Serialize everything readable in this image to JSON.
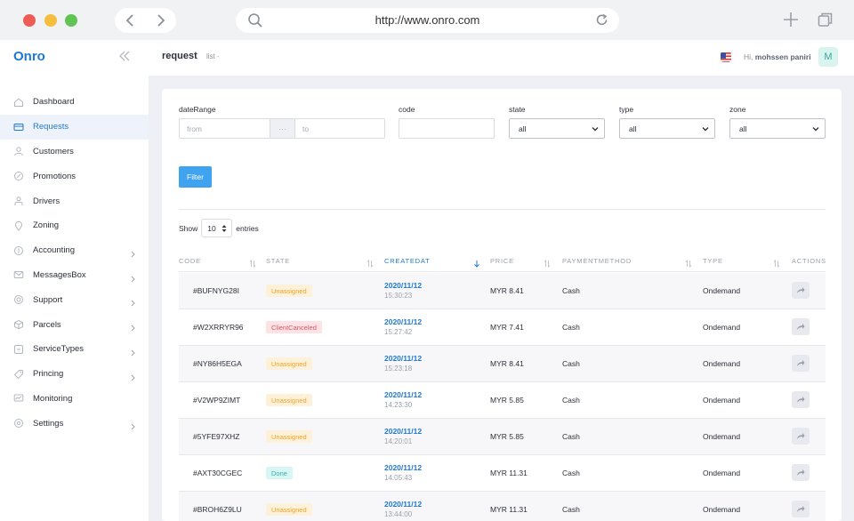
{
  "browser": {
    "url": "http://www.onro.com"
  },
  "sidebar": {
    "logo": "Onro",
    "items": [
      {
        "label": "Dashboard",
        "icon": "home-icon",
        "active": false,
        "chevron": false
      },
      {
        "label": "Requests",
        "icon": "requests-icon",
        "active": true,
        "chevron": false
      },
      {
        "label": "Customers",
        "icon": "customers-icon",
        "active": false,
        "chevron": false
      },
      {
        "label": "Promotions",
        "icon": "promotions-icon",
        "active": false,
        "chevron": false
      },
      {
        "label": "Drivers",
        "icon": "drivers-icon",
        "active": false,
        "chevron": false
      },
      {
        "label": "Zoning",
        "icon": "zoning-icon",
        "active": false,
        "chevron": false
      },
      {
        "label": "Accounting",
        "icon": "accounting-icon",
        "active": false,
        "chevron": true
      },
      {
        "label": "MessagesBox",
        "icon": "messages-icon",
        "active": false,
        "chevron": true
      },
      {
        "label": "Support",
        "icon": "support-icon",
        "active": false,
        "chevron": true
      },
      {
        "label": "Parcels",
        "icon": "parcels-icon",
        "active": false,
        "chevron": true
      },
      {
        "label": "ServiceTypes",
        "icon": "servicetypes-icon",
        "active": false,
        "chevron": true
      },
      {
        "label": "Princing",
        "icon": "pricing-icon",
        "active": false,
        "chevron": true
      },
      {
        "label": "Monitoring",
        "icon": "monitoring-icon",
        "active": false,
        "chevron": false
      },
      {
        "label": "Settings",
        "icon": "settings-icon",
        "active": false,
        "chevron": true
      }
    ]
  },
  "header": {
    "title": "request",
    "crumb": "list",
    "greeting_prefix": "Hi,",
    "user_name": "mohssen paniri",
    "avatar_initial": "M"
  },
  "filters": {
    "date_range_label": "dateRange",
    "from_placeholder": "from",
    "separator": "···",
    "to_placeholder": "to",
    "code_label": "code",
    "state_label": "state",
    "state_value": "all",
    "type_label": "type",
    "type_value": "all",
    "zone_label": "zone",
    "zone_value": "all",
    "filter_button": "Filter"
  },
  "table_controls": {
    "show_label": "Show",
    "entries_value": "10",
    "entries_label": "entries"
  },
  "table": {
    "columns": [
      "CODE",
      "STATE",
      "CREATEDAT",
      "PRICE",
      "PAYMENTMETHOD",
      "TYPE",
      "ACTIONS"
    ],
    "sorted_column": "CREATEDAT",
    "rows": [
      {
        "code": "#BUFNYG28I",
        "state": "Unassigned",
        "state_kind": "unassigned",
        "date": "2020/11/12",
        "time": "15:30:23",
        "price": "MYR 8.41",
        "payment": "Cash",
        "type": "Ondemand"
      },
      {
        "code": "#W2XRRYR96",
        "state": "ClientCanceled",
        "state_kind": "canceled",
        "date": "2020/11/12",
        "time": "15:27:42",
        "price": "MYR 7.41",
        "payment": "Cash",
        "type": "Ondemand"
      },
      {
        "code": "#NY86H5EGA",
        "state": "Unassigned",
        "state_kind": "unassigned",
        "date": "2020/11/12",
        "time": "15:23:18",
        "price": "MYR 8.41",
        "payment": "Cash",
        "type": "Ondemand"
      },
      {
        "code": "#V2WP9ZIMT",
        "state": "Unassigned",
        "state_kind": "unassigned",
        "date": "2020/11/12",
        "time": "14:23:30",
        "price": "MYR 5.85",
        "payment": "Cash",
        "type": "Ondemand"
      },
      {
        "code": "#5YFE97XHZ",
        "state": "Unassigned",
        "state_kind": "unassigned",
        "date": "2020/11/12",
        "time": "14:20:01",
        "price": "MYR 5.85",
        "payment": "Cash",
        "type": "Ondemand"
      },
      {
        "code": "#AXT30CGEC",
        "state": "Done",
        "state_kind": "done",
        "date": "2020/11/12",
        "time": "14:05:43",
        "price": "MYR 11.31",
        "payment": "Cash",
        "type": "Ondemand"
      },
      {
        "code": "#BROH6Z9LU",
        "state": "Unassigned",
        "state_kind": "unassigned",
        "date": "2020/11/12",
        "time": "13:44:00",
        "price": "MYR 11.31",
        "payment": "Cash",
        "type": "Ondemand"
      }
    ]
  },
  "colors": {
    "accent": "#1f78d1",
    "filter_button": "#3fa3f0",
    "unassigned": "#f0a32b",
    "canceled": "#e0525f",
    "done": "#2fb3a9"
  }
}
